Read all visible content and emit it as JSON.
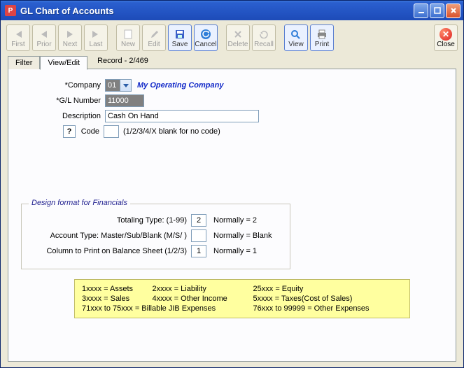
{
  "window": {
    "title": "GL Chart of Accounts"
  },
  "toolbar": {
    "first": "First",
    "prior": "Prior",
    "next": "Next",
    "last": "Last",
    "new": "New",
    "edit": "Edit",
    "save": "Save",
    "cancel": "Cancel",
    "delete": "Delete",
    "recall": "Recall",
    "view": "View",
    "print": "Print",
    "close": "Close"
  },
  "tabs": {
    "filter": "Filter",
    "viewedit": "View/Edit"
  },
  "record": "Record - 2/469",
  "form": {
    "company_label": "*Company",
    "company_code": "01",
    "company_name": "My Operating Company",
    "gl_label": "*G/L Number",
    "gl_value": "11000",
    "desc_label": "Description",
    "desc_value": "Cash On Hand",
    "code_label": "Code",
    "code_value": "",
    "code_hint": "(1/2/3/4/X blank for no code)",
    "help": "?"
  },
  "design": {
    "legend": "Design format for Financials",
    "row1_label": "Totaling Type: (1-99)",
    "row1_value": "2",
    "row1_norm": "Normally = 2",
    "row2_label": "Account Type: Master/Sub/Blank (M/S/ )",
    "row2_value": "",
    "row2_norm": "Normally = Blank",
    "row3_label": "Column to Print on Balance Sheet (1/2/3)",
    "row3_value": "1",
    "row3_norm": "Normally = 1"
  },
  "info": {
    "c1a": "1xxxx = Assets",
    "c2a": "2xxxx = Liability",
    "c3a": "25xxx = Equity",
    "c1b": "3xxxx = Sales",
    "c2b": "4xxxx = Other Income",
    "c3b": "5xxxx = Taxes(Cost of Sales)",
    "c1c": "71xxx to 75xxx = Billable JIB Expenses",
    "c3c": "76xxx to 99999 = Other Expenses"
  }
}
